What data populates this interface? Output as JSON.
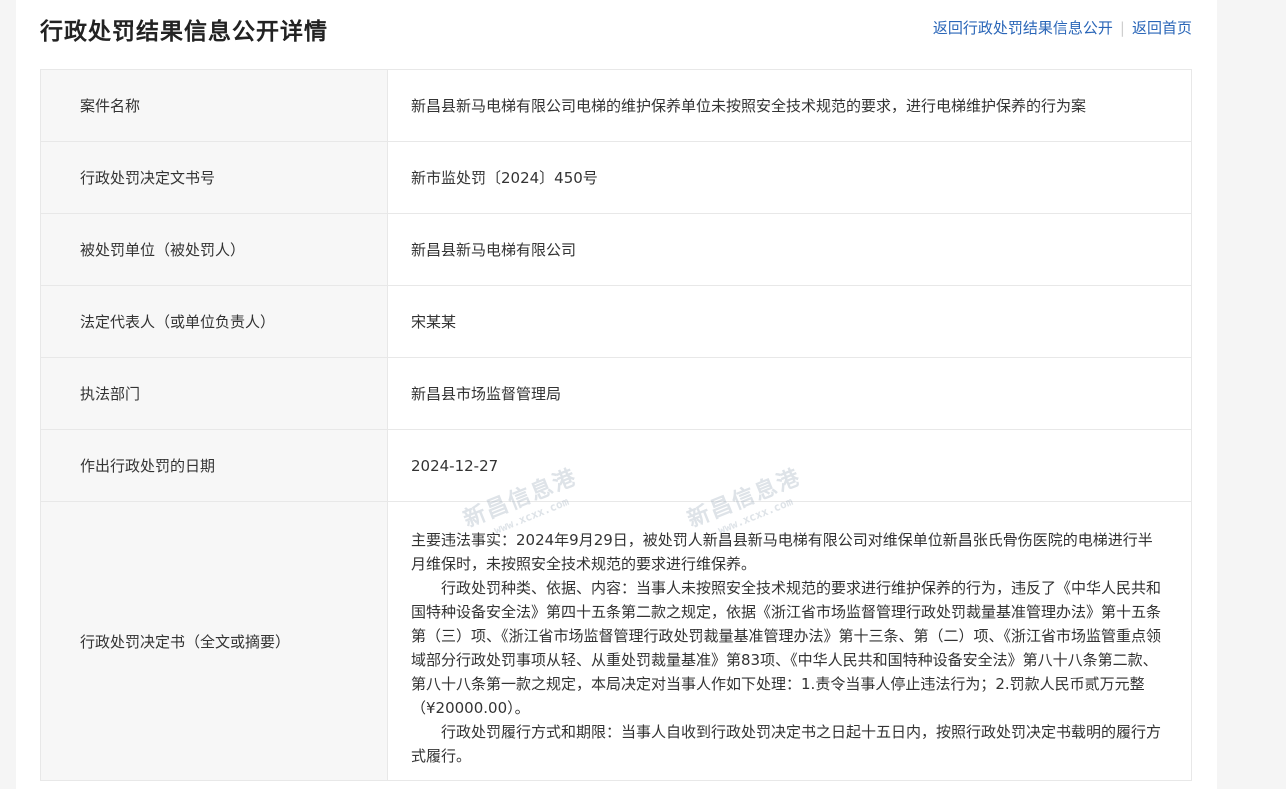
{
  "header": {
    "title": "行政处罚结果信息公开详情",
    "link_back_list": "返回行政处罚结果信息公开",
    "link_home": "返回首页"
  },
  "rows": [
    {
      "label": "案件名称",
      "value": "新昌县新马电梯有限公司电梯的维护保养单位未按照安全技术规范的要求，进行电梯维护保养的行为案"
    },
    {
      "label": "行政处罚决定文书号",
      "value": "新市监处罚〔2024〕450号"
    },
    {
      "label": "被处罚单位（被处罚人）",
      "value": "新昌县新马电梯有限公司"
    },
    {
      "label": "法定代表人（或单位负责人）",
      "value": "宋某某"
    },
    {
      "label": "执法部门",
      "value": "新昌县市场监督管理局"
    },
    {
      "label": "作出行政处罚的日期",
      "value": "2024-12-27"
    }
  ],
  "decision": {
    "label": "行政处罚决定书（全文或摘要）",
    "paragraphs": [
      "主要违法事实：2024年9月29日，被处罚人新昌县新马电梯有限公司对维保单位新昌张氏骨伤医院的电梯进行半月维保时，未按照安全技术规范的要求进行维保养。",
      "行政处罚种类、依据、内容：当事人未按照安全技术规范的要求进行维护保养的行为，违反了《中华人民共和国特种设备安全法》第四十五条第二款之规定，依据《浙江省市场监督管理行政处罚裁量基准管理办法》第十五条第（三）项、《浙江省市场监督管理行政处罚裁量基准管理办法》第十三条、第（二）项、《浙江省市场监管重点领域部分行政处罚事项从轻、从重处罚裁量基准》第83项、《中华人民共和国特种设备安全法》第八十八条第二款、第八十八条第一款之规定，本局决定对当事人作如下处理：1.责令当事人停止违法行为；2.罚款人民币贰万元整（¥20000.00）。",
      "行政处罚履行方式和期限：当事人自收到行政处罚决定书之日起十五日内，按照行政处罚决定书载明的履行方式履行。"
    ]
  },
  "watermark": {
    "logo_text": "新昌信息港",
    "url_text": "www.xcxx.com"
  }
}
